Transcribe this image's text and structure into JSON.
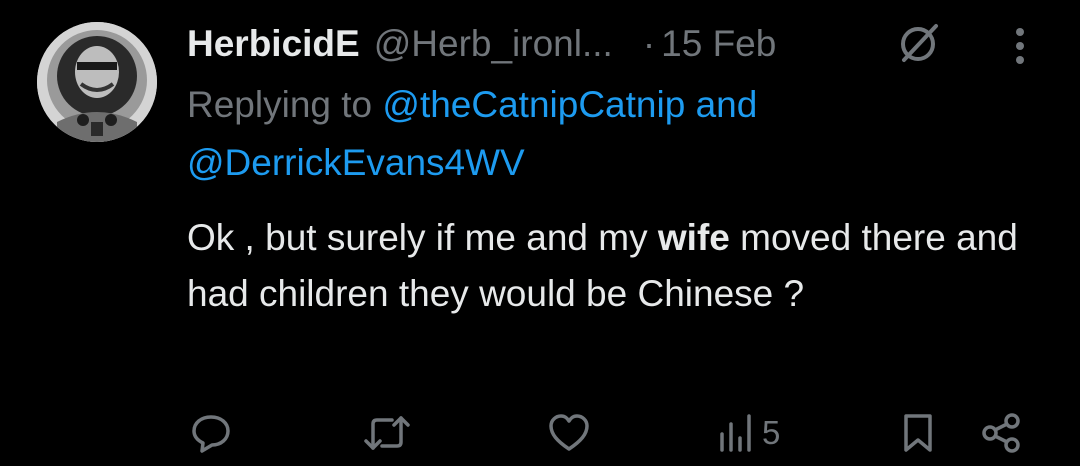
{
  "tweet": {
    "display_name": "HerbicidE",
    "handle": "@Herb_ironl...",
    "separator": "·",
    "date": "15 Feb",
    "replying_prefix": "Replying to ",
    "mention_1": "@theCatnipCatnip",
    "mention_joiner": " and",
    "mention_2": "@DerrickEvans4WV",
    "text_before": "Ok , but surely if me and my ",
    "text_bold": "wife",
    "text_after": " moved there and had children they would be Chinese ?"
  },
  "actions": {
    "reply_icon": "speech-bubble",
    "retweet_icon": "retweet-arrows",
    "like_icon": "heart-outline",
    "views_icon": "bar-chart",
    "views_count": "5",
    "bookmark_icon": "bookmark-outline",
    "share_icon": "share-nodes"
  },
  "header_icons": {
    "grok": "grok-slash-circle",
    "more": "vertical-ellipsis"
  },
  "colors": {
    "background": "#000000",
    "primary_text": "#e7e9ea",
    "secondary_text": "#71767b",
    "mention": "#1d9bf0"
  }
}
